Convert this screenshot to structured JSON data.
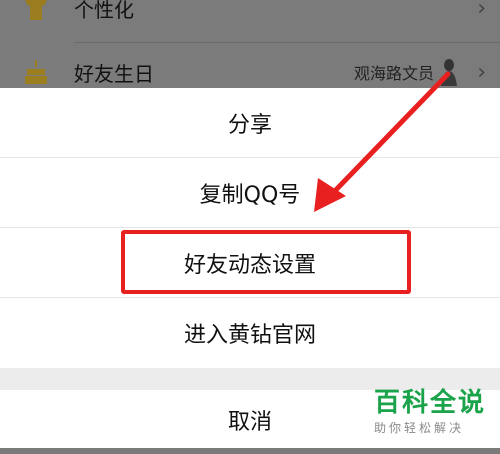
{
  "background_list": {
    "rows": [
      {
        "label": "个性化",
        "value": "",
        "icon": "shirt-icon"
      },
      {
        "label": "好友生日",
        "value": "观海路文员",
        "icon": "cake-icon"
      }
    ]
  },
  "action_sheet": {
    "items": [
      {
        "label": "分享"
      },
      {
        "label": "复制QQ号"
      },
      {
        "label": "好友动态设置"
      },
      {
        "label": "进入黄钻官网"
      }
    ],
    "cancel_label": "取消"
  },
  "annotation": {
    "highlight_color": "#e8201f"
  },
  "watermark": {
    "title": "百科全说",
    "subtitle": "助你轻松解决",
    "color": "#1aa34a"
  }
}
